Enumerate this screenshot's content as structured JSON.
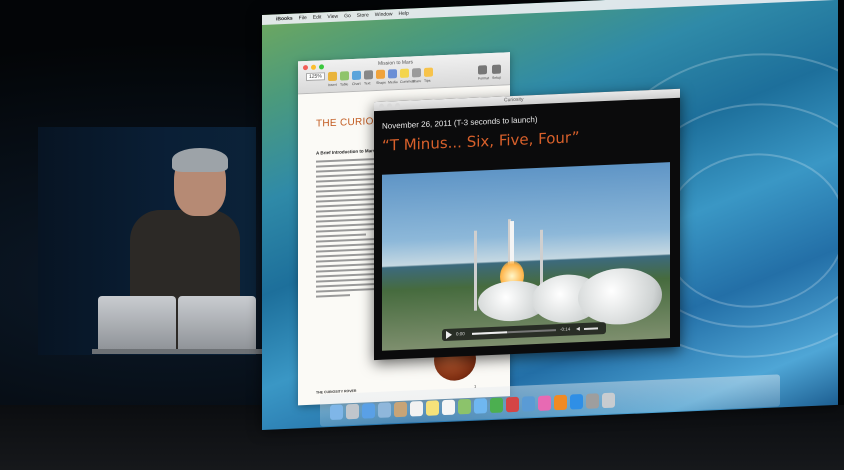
{
  "menubar": {
    "app_name": "iBooks",
    "items": [
      "File",
      "Edit",
      "View",
      "Go",
      "Store",
      "Window",
      "Help"
    ]
  },
  "pages_window": {
    "title": "Mission to Mars",
    "zoom": "125%",
    "doc_title": "THE CURIOSITY ROVER",
    "doc_subtitle": "A Brief Introduction to Mars",
    "footer": "THE CURIOSITY ROVER",
    "page_number": "1",
    "toolbar_labels": [
      "Insert",
      "Table",
      "Chart",
      "Text",
      "Shape",
      "Media",
      "Comment",
      "Share",
      "Tips",
      "Format",
      "Setup"
    ]
  },
  "ibooks_window": {
    "title": "Curiosity",
    "date_line": "November 26, 2011 (T-3 seconds to launch)",
    "heading": "“T Minus... Six, Five, Four”",
    "video": {
      "time_elapsed": "0:00",
      "time_remaining": "-0:14",
      "progress": 0.42
    }
  },
  "dock": {
    "apps": [
      "finder-icon",
      "launchpad-icon",
      "safari-icon",
      "mail-icon",
      "contacts-icon",
      "calendar-icon",
      "notes-icon",
      "reminders-icon",
      "maps-icon",
      "messages-icon",
      "facetime-icon",
      "photo-booth-icon",
      "iphoto-icon",
      "itunes-icon",
      "ibooks-icon",
      "app-store-icon",
      "system-preferences-icon",
      "trash-icon"
    ]
  }
}
